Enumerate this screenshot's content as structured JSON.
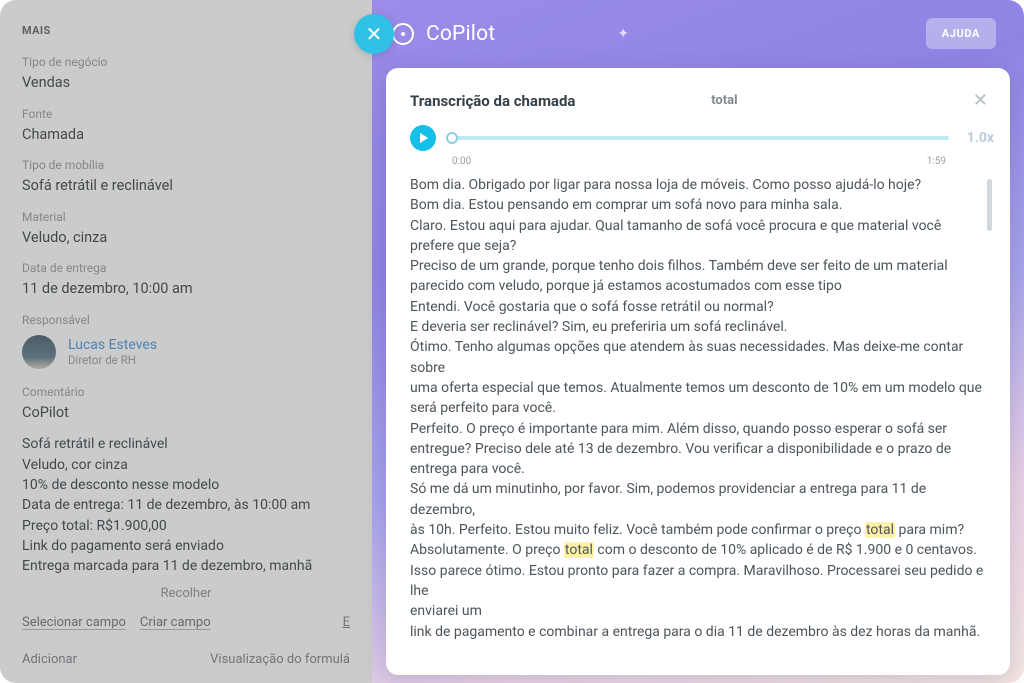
{
  "left": {
    "section": "MAIS",
    "fields": {
      "business_type_label": "Tipo de negócio",
      "business_type": "Vendas",
      "source_label": "Fonte",
      "source": "Chamada",
      "furniture_type_label": "Tipo de mobília",
      "furniture_type": "Sofá retrátil e reclinável",
      "material_label": "Material",
      "material": "Veludo, cinza",
      "delivery_label": "Data de entrega",
      "delivery": "11 de dezembro, 10:00 am",
      "responsible_label": "Responsável"
    },
    "responsible": {
      "name": "Lucas Esteves",
      "role": "Diretor de RH"
    },
    "comment_label": "Comentário",
    "comment_title": "CoPilot",
    "comment_lines": {
      "l1": "Sofá retrátil e reclinável",
      "l2": "Veludo, cor cinza",
      "l3": "10% de desconto nesse modelo",
      "l4": "Data de entrega: 11 de dezembro, às 10:00 am",
      "l5": "Preço total: R$1.900,00",
      "l6": "Link do pagamento será enviado",
      "l7": "Entrega marcada para 11 de dezembro, manhã"
    },
    "collapse": "Recolher",
    "select_field": "Selecionar campo",
    "create_field": "Criar campo",
    "bottom_e": "E",
    "add": "Adicionar",
    "form_view": "Visualização do formulá"
  },
  "copilot": {
    "brand": "CoPilot",
    "help": "AJUDA"
  },
  "card": {
    "title": "Transcrição da chamada",
    "search": "total",
    "time_start": "0:00",
    "time_end": "1:59",
    "speed": "1.0x"
  },
  "transcript": {
    "p1": "Bom dia. Obrigado por ligar para nossa loja de móveis. Como posso ajudá-lo hoje?",
    "p2": "Bom dia. Estou pensando em comprar um sofá novo para minha sala.",
    "p3": "Claro. Estou aqui para ajudar. Qual tamanho de sofá você procura e que material você prefere que seja?",
    "p4": "Preciso de um grande, porque tenho dois filhos. Também deve ser feito de um material parecido com veludo, porque já estamos acostumados com esse tipo",
    "p5": "Entendi. Você gostaria que o sofá fosse retrátil ou normal?",
    "p6": "E deveria ser reclinável? Sim, eu preferiria um sofá reclinável.",
    "p7": "Ótimo. Tenho algumas opções que atendem às suas necessidades. Mas deixe-me contar sobre",
    "p8": "uma oferta especial que temos. Atualmente temos um desconto de 10% em um modelo que será perfeito para você.",
    "p9": "Perfeito. O preço é importante para mim. Além disso, quando posso esperar o sofá ser entregue? Preciso dele até 13 de dezembro. Vou verificar a disponibilidade e o prazo de entrega para você.",
    "p10": "Só me dá um minutinho, por favor. Sim, podemos providenciar a entrega para 11 de dezembro,",
    "p11a": "às 10h. Perfeito. Estou muito feliz. Você também pode confirmar o preço ",
    "p11b": " para mim?",
    "p12a": "Absolutamente. O preço ",
    "p12b": " com o desconto de 10% aplicado é de R$ 1.900 e 0 centavos.",
    "p13": "Isso parece ótimo. Estou pronto para fazer a compra. Maravilhoso. Processarei seu pedido e lhe",
    "p14": "enviarei um",
    "p15": "link de pagamento e combinar a entrega para o dia 11 de dezembro às dez horas da manhã.",
    "hl": "total"
  }
}
